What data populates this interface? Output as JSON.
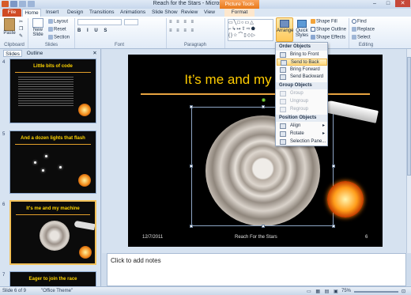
{
  "window": {
    "title": "Reach for the Stars - Microsoft PowerPoint",
    "context_tab": "Picture Tools",
    "buttons": [
      "–",
      "□",
      "✕"
    ]
  },
  "tabs": [
    "File",
    "Home",
    "Insert",
    "Design",
    "Transitions",
    "Animations",
    "Slide Show",
    "Review",
    "View",
    "Format"
  ],
  "ribbon": {
    "clipboard": {
      "paste": "Paste",
      "label": "Clipboard"
    },
    "slides": {
      "new_slide": "New Slide",
      "layout": "Layout",
      "reset": "Reset",
      "section": "Section",
      "label": "Slides"
    },
    "font": {
      "label": "Font"
    },
    "paragraph": {
      "label": "Paragraph"
    },
    "drawing": {
      "arrange": "Arrange",
      "quick_styles": "Quick Styles",
      "shape_fill": "Shape Fill",
      "shape_outline": "Shape Outline",
      "shape_effects": "Shape Effects"
    },
    "editing": {
      "find": "Find",
      "replace": "Replace",
      "select": "Select",
      "label": "Editing"
    }
  },
  "pane_tabs": [
    "Slides",
    "Outline"
  ],
  "thumbnails": [
    {
      "num": "4",
      "title": "Little bits of code"
    },
    {
      "num": "5",
      "title": "And a dozen lights that flash"
    },
    {
      "num": "6",
      "title": "It's me and my machine"
    },
    {
      "num": "7",
      "title": "Eager to join the race"
    }
  ],
  "slide": {
    "title": "It’s me and my machine",
    "date": "12/7/2011",
    "footer": "Reach For the Stars",
    "number": "6"
  },
  "notes": {
    "placeholder": "Click to add notes"
  },
  "menu": {
    "order_header": "Order Objects",
    "order": [
      "Bring to Front",
      "Send to Back",
      "Bring Forward",
      "Send Backward"
    ],
    "group_header": "Group Objects",
    "group": [
      "Group",
      "Ungroup",
      "Regroup"
    ],
    "position_header": "Position Objects",
    "position": [
      "Align",
      "Rotate",
      "Selection Pane..."
    ]
  },
  "status": {
    "slide": "Slide 6 of 9",
    "theme": "\"Office Theme\"",
    "zoom": "75%"
  },
  "colors": {
    "accent": "#d04b24",
    "title": "#ffcc00",
    "highlight": "#ffd97d"
  }
}
